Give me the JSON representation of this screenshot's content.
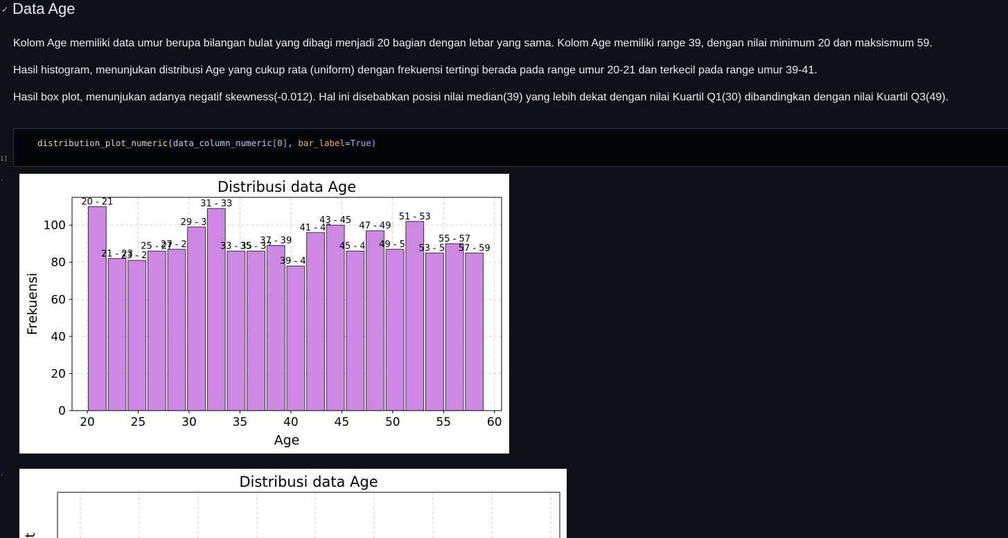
{
  "section": {
    "chevron": "✓",
    "title": "Data Age"
  },
  "markdown": {
    "p1": "Kolom Age memiliki data umur berupa bilangan bulat yang dibagi menjadi 20 bagian dengan lebar yang sama. Kolom Age memiliki range 39, dengan nilai minimum 20 dan maksismum 59.",
    "p2": "Hasil histogram, menunjukan distribusi Age yang cukup rata (uniform) dengan frekuensi tertingi berada pada range umur 20-21 dan terkecil pada range umur 39-41.",
    "p3": "Hasil box plot, menunjukan adanya negatif skewness(-0.012). Hal ini disebabkan posisi nilai median(39) yang lebih dekat dengan nilai Kuartil Q1(30) dibandingkan dengan nilai Kuartil Q3(49)."
  },
  "code": {
    "fn": "distribution_plot_numeric",
    "open": "(",
    "arg": "data_column_numeric",
    "lbr": "[",
    "idx": "0",
    "rbr": "]",
    "sep": ", ",
    "kw": "bar_label",
    "eq": "=",
    "val": "True",
    "close": ")"
  },
  "exec_count": "1]",
  "output_dot": ".",
  "chart_data": [
    {
      "type": "bar",
      "title": "Distribusi data Age",
      "xlabel": "Age",
      "ylabel": "Frekuensi",
      "xlim": [
        18.5,
        60.7
      ],
      "ylim": [
        0,
        115
      ],
      "xticks": [
        20,
        25,
        30,
        35,
        40,
        45,
        50,
        55,
        60
      ],
      "yticks": [
        0,
        20,
        40,
        60,
        80,
        100
      ],
      "grid": true,
      "bar_color": "#cc88e3",
      "bin_edges": [
        20,
        21.95,
        23.9,
        25.85,
        27.8,
        29.75,
        31.7,
        33.65,
        35.6,
        37.55,
        39.5,
        41.45,
        43.4,
        45.35,
        47.3,
        49.25,
        51.2,
        53.15,
        55.1,
        57.05,
        59
      ],
      "bar_labels": [
        "20 - 21",
        "21 - 23",
        "23 - 25",
        "25 - 27",
        "27 - 29",
        "29 - 31",
        "31 - 33",
        "33 - 35",
        "35 - 37",
        "37 - 39",
        "39 - 41",
        "41 - 43",
        "43 - 45",
        "45 - 47",
        "47 - 49",
        "49 - 51",
        "51 - 53",
        "53 - 55",
        "55 - 57",
        "57 - 59"
      ],
      "values": [
        110,
        82,
        81,
        86,
        87,
        99,
        109,
        86,
        86,
        89,
        78,
        96,
        100,
        86,
        97,
        87,
        102,
        85,
        90,
        85
      ]
    },
    {
      "type": "box",
      "title": "Distribusi data Age",
      "ylabel": "t",
      "grid": true
    }
  ]
}
